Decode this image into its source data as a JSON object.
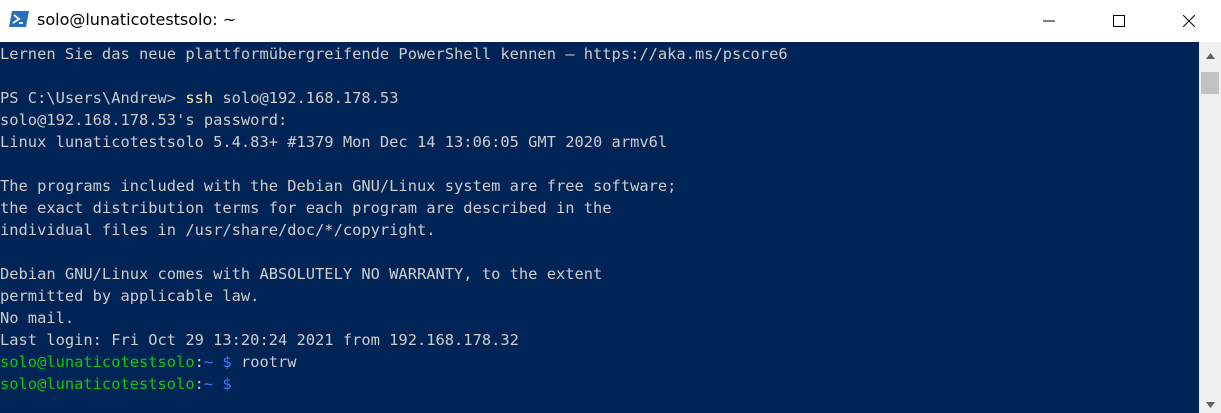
{
  "window": {
    "title": "solo@lunaticotestsolo: ~",
    "icon": "powershell-icon",
    "controls": [
      "minimize-icon",
      "maximize-icon",
      "close-icon"
    ]
  },
  "terminal": {
    "colors": {
      "background": "#012456",
      "text": "#cccccc",
      "command": "#f9f1a5",
      "prompt_user": "#13c60e",
      "prompt_path": "#3b78ff"
    },
    "lines": [
      {
        "text": "Lernen Sie das neue plattformübergreifende PowerShell kennen – https://aka.ms/pscore6"
      },
      {
        "text": ""
      },
      {
        "prefix": "PS C:\\Users\\Andrew> ",
        "command": "ssh",
        "args": " solo@192.168.178.53"
      },
      {
        "text": "solo@192.168.178.53's password:"
      },
      {
        "text": "Linux lunaticotestsolo 5.4.83+ #1379 Mon Dec 14 13:06:05 GMT 2020 armv6l"
      },
      {
        "text": ""
      },
      {
        "text": "The programs included with the Debian GNU/Linux system are free software;"
      },
      {
        "text": "the exact distribution terms for each program are described in the"
      },
      {
        "text": "individual files in /usr/share/doc/*/copyright."
      },
      {
        "text": ""
      },
      {
        "text": "Debian GNU/Linux comes with ABSOLUTELY NO WARRANTY, to the extent"
      },
      {
        "text": "permitted by applicable law."
      },
      {
        "text": "No mail."
      },
      {
        "text": "Last login: Fri Oct 29 13:20:24 2021 from 192.168.178.32"
      },
      {
        "user": "solo@lunaticotestsolo",
        "sep": ":",
        "path": "~ $",
        "command": " rootrw"
      },
      {
        "user": "solo@lunaticotestsolo",
        "sep": ":",
        "path": "~ $",
        "command": ""
      }
    ]
  }
}
